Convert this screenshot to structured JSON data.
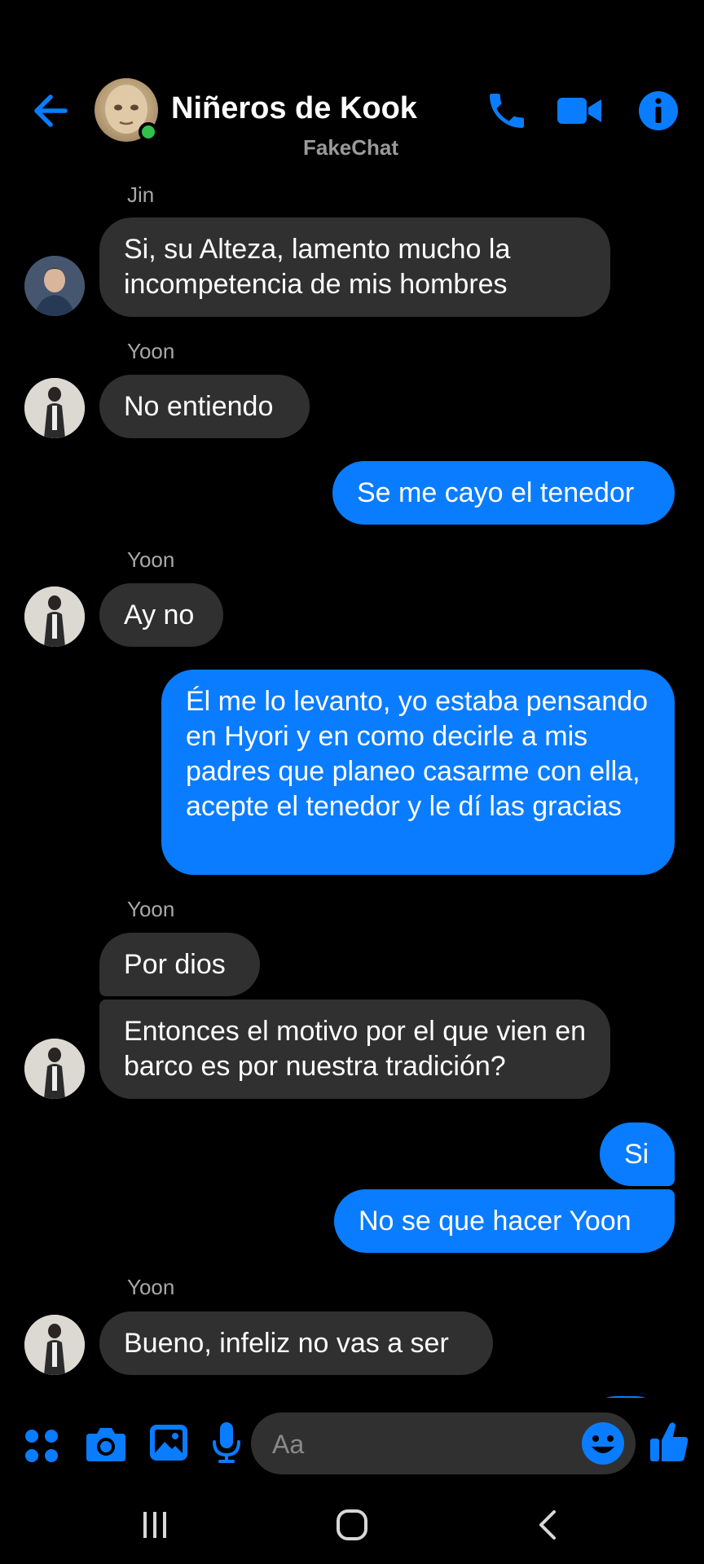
{
  "header": {
    "title": "Niñeros de Kook",
    "subtitle": "FakeChat",
    "accent_color": "#0a7cff",
    "online_color": "#31c24d",
    "icons": [
      "back-arrow-icon",
      "phone-icon",
      "video-camera-icon",
      "info-icon"
    ]
  },
  "messages": [
    {
      "sender": "Jin",
      "direction": "incoming",
      "text": "Si, su Alteza, lamento mucho la incompetencia de mis hombres"
    },
    {
      "sender": "Yoon",
      "direction": "incoming",
      "text": "No entiendo"
    },
    {
      "direction": "outgoing",
      "text": "Se me cayo el tenedor"
    },
    {
      "sender": "Yoon",
      "direction": "incoming",
      "text": "Ay no"
    },
    {
      "direction": "outgoing",
      "text": "Él me lo levanto, yo estaba pensando en Hyori y en como decirle a mis padres que planeo casarme con ella, acepte el tenedor y le dí las gracias"
    },
    {
      "sender": "Yoon",
      "direction": "incoming",
      "text": "Por dios"
    },
    {
      "sender": "Yoon",
      "direction": "incoming",
      "text": "Entonces el motivo por el que vien en barco es por nuestra tradición?"
    },
    {
      "direction": "outgoing",
      "text": "Si"
    },
    {
      "direction": "outgoing",
      "text": "No se que hacer Yoon"
    },
    {
      "sender": "Yoon",
      "direction": "incoming",
      "text": "Bueno, infeliz no vas a ser"
    }
  ],
  "composer": {
    "placeholder": "Aa",
    "icons": [
      "apps-grid-icon",
      "camera-icon",
      "gallery-icon",
      "microphone-icon",
      "emoji-icon",
      "thumbs-up-icon"
    ]
  },
  "navbar": {
    "icons": [
      "recent-apps-icon",
      "home-icon",
      "back-icon"
    ]
  },
  "colors": {
    "background": "#000000",
    "incoming_bubble": "#303030",
    "outgoing_bubble": "#0a7cff",
    "muted_text": "#a8a8a8"
  }
}
